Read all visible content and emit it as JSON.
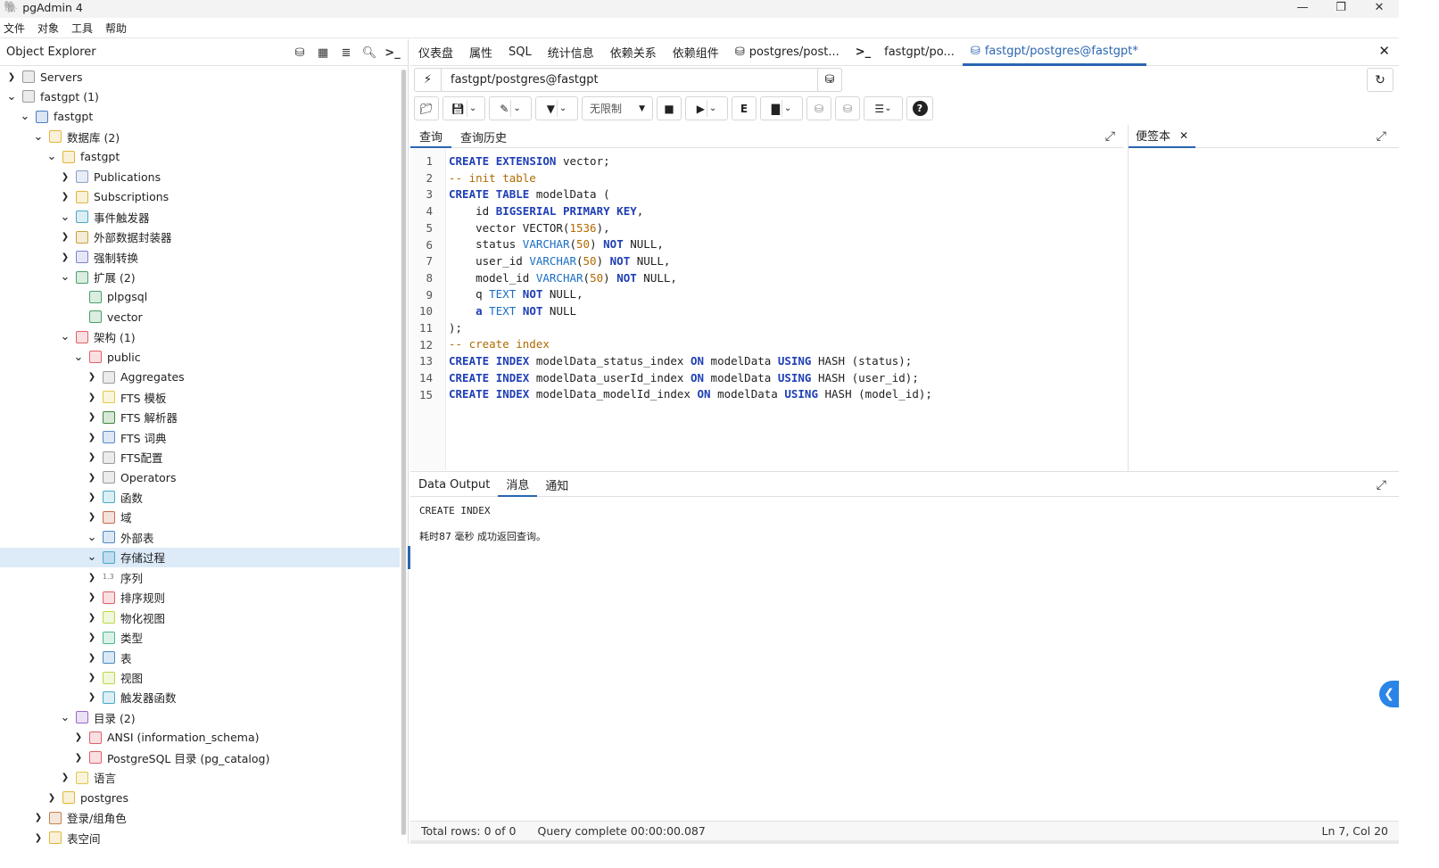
{
  "titlebar": {
    "app_title": "pgAdmin 4",
    "minimize": "—",
    "restore": "❐",
    "close": "✕"
  },
  "menu": [
    "文件",
    "对象",
    "工具",
    "帮助"
  ],
  "explorer": {
    "title": "Object Explorer",
    "tree": [
      {
        "label": "Servers",
        "depth": 0,
        "chev": "right",
        "icon": "servers-icon",
        "color": "#9a9a9a"
      },
      {
        "label": "fastgpt (1)",
        "depth": 0,
        "chev": "down",
        "icon": "server-group-icon",
        "color": "#9a9a9a"
      },
      {
        "label": "fastgpt",
        "depth": 1,
        "chev": "down",
        "icon": "elephant-icon",
        "color": "#4a7fc1"
      },
      {
        "label": "数据库 (2)",
        "depth": 2,
        "chev": "down",
        "icon": "databases-icon",
        "color": "#e2b63c"
      },
      {
        "label": "fastgpt",
        "depth": 3,
        "chev": "down",
        "icon": "database-icon",
        "color": "#e2b63c"
      },
      {
        "label": "Publications",
        "depth": 4,
        "chev": "right",
        "icon": "publication-icon",
        "color": "#8aa0c8"
      },
      {
        "label": "Subscriptions",
        "depth": 4,
        "chev": "right",
        "icon": "subscription-icon",
        "color": "#e2b63c"
      },
      {
        "label": "事件触发器",
        "depth": 4,
        "chev": "down",
        "icon": "event-trigger-icon",
        "color": "#4aa8c8"
      },
      {
        "label": "外部数据封装器",
        "depth": 4,
        "chev": "right",
        "icon": "fdw-icon",
        "color": "#c9a23a"
      },
      {
        "label": "强制转换",
        "depth": 4,
        "chev": "right",
        "icon": "cast-icon",
        "color": "#7c82d0"
      },
      {
        "label": "扩展 (2)",
        "depth": 4,
        "chev": "down",
        "icon": "extensions-icon",
        "color": "#4aa06a"
      },
      {
        "label": "plpgsql",
        "depth": 5,
        "chev": "none",
        "icon": "extension-icon",
        "color": "#4aa06a"
      },
      {
        "label": "vector",
        "depth": 5,
        "chev": "none",
        "icon": "extension-icon",
        "color": "#4aa06a"
      },
      {
        "label": "架构 (1)",
        "depth": 4,
        "chev": "down",
        "icon": "schemas-icon",
        "color": "#e0606a"
      },
      {
        "label": "public",
        "depth": 5,
        "chev": "down",
        "icon": "schema-icon",
        "color": "#e0606a"
      },
      {
        "label": "Aggregates",
        "depth": 6,
        "chev": "right",
        "icon": "aggregate-icon",
        "color": "#9a9a9a"
      },
      {
        "label": "FTS 模板",
        "depth": 6,
        "chev": "right",
        "icon": "fts-template-icon",
        "color": "#e2c84a"
      },
      {
        "label": "FTS 解析器",
        "depth": 6,
        "chev": "right",
        "icon": "fts-parser-icon",
        "color": "#3a8a3a"
      },
      {
        "label": "FTS 词典",
        "depth": 6,
        "chev": "right",
        "icon": "fts-dictionary-icon",
        "color": "#5a8ac8"
      },
      {
        "label": "FTS配置",
        "depth": 6,
        "chev": "right",
        "icon": "fts-config-icon",
        "color": "#9a9a9a"
      },
      {
        "label": "Operators",
        "depth": 6,
        "chev": "right",
        "icon": "operator-icon",
        "color": "#9a9a9a"
      },
      {
        "label": "函数",
        "depth": 6,
        "chev": "right",
        "icon": "function-icon",
        "color": "#4aa8c8"
      },
      {
        "label": "域",
        "depth": 6,
        "chev": "right",
        "icon": "domain-icon",
        "color": "#c86a4a"
      },
      {
        "label": "外部表",
        "depth": 6,
        "chev": "down",
        "icon": "foreign-table-icon",
        "color": "#4a8ac8"
      },
      {
        "label": "存储过程",
        "depth": 6,
        "chev": "down",
        "icon": "procedure-icon",
        "color": "#4aa8c8",
        "selected": true
      },
      {
        "label": "序列",
        "depth": 6,
        "chev": "right",
        "icon": "sequence-icon",
        "color": "#777777",
        "glyph": "1.3"
      },
      {
        "label": "排序规则",
        "depth": 6,
        "chev": "right",
        "icon": "collation-icon",
        "color": "#e0606a"
      },
      {
        "label": "物化视图",
        "depth": 6,
        "chev": "right",
        "icon": "mview-icon",
        "color": "#b8d84a"
      },
      {
        "label": "类型",
        "depth": 6,
        "chev": "right",
        "icon": "type-icon",
        "color": "#4ab88a"
      },
      {
        "label": "表",
        "depth": 6,
        "chev": "right",
        "icon": "table-icon",
        "color": "#4a8ac8"
      },
      {
        "label": "视图",
        "depth": 6,
        "chev": "right",
        "icon": "view-icon",
        "color": "#b8d84a"
      },
      {
        "label": "触发器函数",
        "depth": 6,
        "chev": "right",
        "icon": "trigger-function-icon",
        "color": "#4aa8c8"
      },
      {
        "label": "目录 (2)",
        "depth": 4,
        "chev": "down",
        "icon": "catalogs-icon",
        "color": "#9a6ac8"
      },
      {
        "label": "ANSI (information_schema)",
        "depth": 5,
        "chev": "right",
        "icon": "catalog-icon",
        "color": "#e0606a"
      },
      {
        "label": "PostgreSQL 目录 (pg_catalog)",
        "depth": 5,
        "chev": "right",
        "icon": "catalog-icon",
        "color": "#e0606a"
      },
      {
        "label": "语言",
        "depth": 4,
        "chev": "right",
        "icon": "language-icon",
        "color": "#e2c84a"
      },
      {
        "label": "postgres",
        "depth": 3,
        "chev": "right",
        "icon": "database-icon",
        "color": "#e2b63c"
      },
      {
        "label": "登录/组角色",
        "depth": 2,
        "chev": "right",
        "icon": "roles-icon",
        "color": "#c8804a"
      },
      {
        "label": "表空间",
        "depth": 2,
        "chev": "right",
        "icon": "tablespace-icon",
        "color": "#e2b63c"
      }
    ]
  },
  "tabs": [
    {
      "label": "仪表盘",
      "icon": ""
    },
    {
      "label": "属性",
      "icon": ""
    },
    {
      "label": "SQL",
      "icon": ""
    },
    {
      "label": "统计信息",
      "icon": ""
    },
    {
      "label": "依赖关系",
      "icon": ""
    },
    {
      "label": "依赖组件",
      "icon": ""
    },
    {
      "label": "postgres/post...",
      "icon": "db"
    },
    {
      "label": "fastgpt/po...",
      "icon": "psql"
    },
    {
      "label": "fastgpt/postgres@fastgpt*",
      "icon": "db",
      "active": true
    }
  ],
  "connection": {
    "label": "fastgpt/postgres@fastgpt"
  },
  "toolbar": {
    "limit_label": "无限制"
  },
  "query_tabs": [
    "查询",
    "查询历史"
  ],
  "scratch_pad": {
    "title": "便签本",
    "close": "✕"
  },
  "editor": {
    "line_numbers": [
      "1",
      "2",
      "3",
      "4",
      "5",
      "6",
      "7",
      "8",
      "9",
      "10",
      "11",
      "12",
      "13",
      "14",
      "15"
    ]
  },
  "result_tabs": [
    "Data Output",
    "消息",
    "通知"
  ],
  "messages": {
    "line1": "CREATE INDEX",
    "line2": "耗时87 毫秒 成功返回查询。"
  },
  "status": {
    "rows": "Total rows: 0 of 0",
    "query": "Query complete 00:00:00.087",
    "cursor": "Ln 7, Col 20"
  }
}
